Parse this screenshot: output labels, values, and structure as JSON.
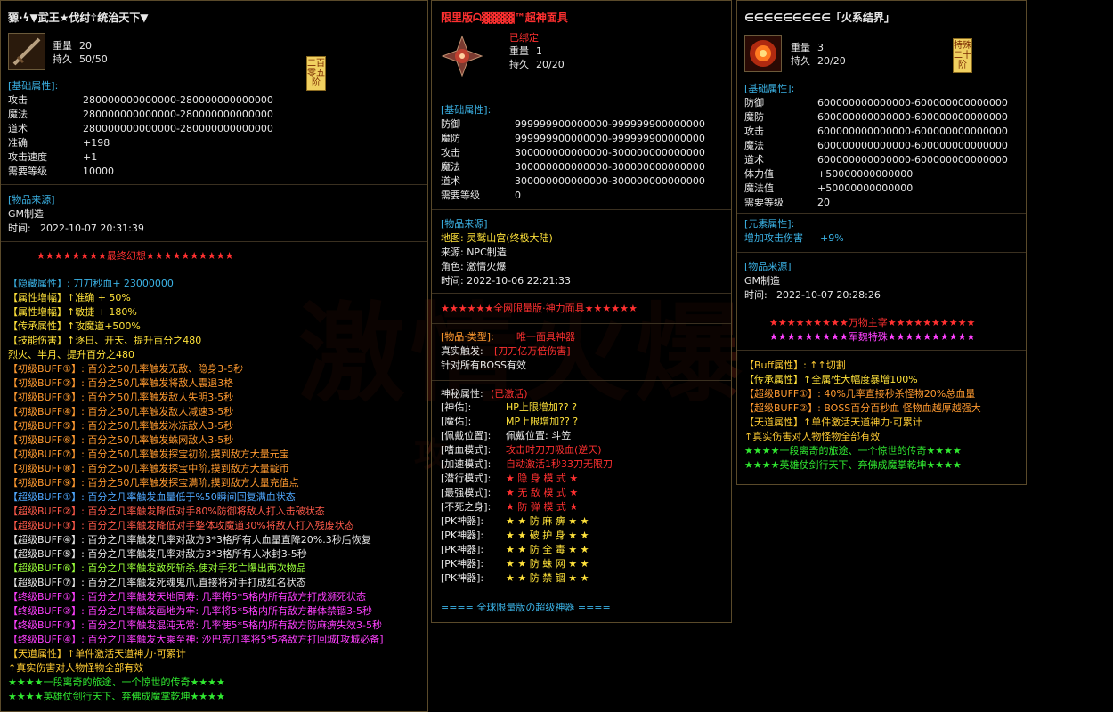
{
  "p1": {
    "title": "豲·ϟ▼武王★伐纣☦统治天下▼",
    "weight_label": "重量",
    "weight": "20",
    "durability_label": "持久",
    "durability": "50/50",
    "seal": "二百零五阶",
    "base_header": "[基础属性]:",
    "base": [
      {
        "k": "攻击",
        "v": "280000000000000-280000000000000"
      },
      {
        "k": "魔法",
        "v": "280000000000000-280000000000000"
      },
      {
        "k": "道术",
        "v": "280000000000000-280000000000000"
      },
      {
        "k": "准确",
        "v": "+198"
      },
      {
        "k": "攻击速度",
        "v": "+1"
      },
      {
        "k": "需要等级",
        "v": "10000"
      }
    ],
    "source_header": "[物品来源]",
    "source": "GM制造",
    "time_label": "时间:",
    "time": "2022-10-07 20:31:39",
    "banner": "★★★★★★★★最终幻想★★★★★★★★★★",
    "lines": [
      {
        "t": "【隐藏属性】: 刀刀秒血+ 23000000",
        "c": "c-cyan"
      },
      {
        "t": "【属性增幅】↑准确 + 50%",
        "c": "c-yellow"
      },
      {
        "t": "【属性增幅】↑敏捷 + 180%",
        "c": "c-yellow"
      },
      {
        "t": "【传承属性】↑攻魔道+500%",
        "c": "c-yellow"
      },
      {
        "t": "【技能伤害】↑逐日、开天、提升百分之480",
        "c": "c-yellow"
      },
      {
        "t": "              烈火、半月、提升百分之480",
        "c": "c-yellow"
      },
      {
        "t": "【初级BUFF①】: 百分之50几率触发无敌、隐身3-5秒",
        "c": "c-orange"
      },
      {
        "t": "【初级BUFF②】: 百分之50几率触发将敌人震退3格",
        "c": "c-orange"
      },
      {
        "t": "【初级BUFF③】: 百分之50几率触发敌人失明3-5秒",
        "c": "c-orange"
      },
      {
        "t": "【初级BUFF④】: 百分之50几率触发敌人减速3-5秒",
        "c": "c-orange"
      },
      {
        "t": "【初级BUFF⑤】: 百分之50几率触发冰冻敌人3-5秒",
        "c": "c-orange"
      },
      {
        "t": "【初级BUFF⑥】: 百分之50几率触发蛛网敌人3-5秒",
        "c": "c-orange"
      },
      {
        "t": "【初级BUFF⑦】: 百分之50几率触发探宝初阶,摸到敌方大量元宝",
        "c": "c-orange"
      },
      {
        "t": "【初级BUFF⑧】: 百分之50几率触发探宝中阶,摸到敌方大量靛币",
        "c": "c-orange"
      },
      {
        "t": "【初级BUFF⑨】: 百分之50几率触发探宝满阶,摸到敌方大量充值点",
        "c": "c-orange"
      },
      {
        "t": "【超级BUFF①】: 百分之几率触发血量低于%50瞬间回复满血状态",
        "c": "c-blue"
      },
      {
        "t": "【超级BUFF②】: 百分之几率触发降低对手80%防御将敌人打入击破状态",
        "c": "c-redl"
      },
      {
        "t": "【超级BUFF③】: 百分之几率触发降低对手整体攻魔道30%将敌人打入残废状态",
        "c": "c-redl"
      },
      {
        "t": "【超级BUFF④】: 百分之几率触发几率对敌方3*3格所有人血量直降20%.3秒后恢复",
        "c": "c-white"
      },
      {
        "t": "【超级BUFF⑤】: 百分之几率触发几率对敌方3*3格所有人冰封3-5秒",
        "c": "c-white"
      },
      {
        "t": "【超级BUFF⑥】: 百分之几率触发致死斩杀,使对手死亡爆出两次物品",
        "c": "c-lime"
      },
      {
        "t": "【超级BUFF⑦】: 百分之几率触发死魂鬼爪,直接将对手打成红名状态",
        "c": "c-white"
      },
      {
        "t": "【终级BUFF①】: 百分之几率触发天地同寿: 几率将5*5格内所有敌方打成濒死状态",
        "c": "c-magenta"
      },
      {
        "t": "【终级BUFF②】: 百分之几率触发画地为牢: 几率将5*5格内所有敌方群体禁锢3-5秒",
        "c": "c-magenta"
      },
      {
        "t": "【终级BUFF③】: 百分之几率触发混沌无常: 几率使5*5格内所有敌方防麻痹失效3-5秒",
        "c": "c-magenta"
      },
      {
        "t": "【终级BUFF④】: 百分之几率触发大乘至神: 沙巴克几率将5*5格敌方打回城[攻城必备]",
        "c": "c-magenta"
      },
      {
        "t": "         【天道属性】↑单件激活天道神力·可累计",
        "c": "c-gold"
      },
      {
        "t": "                 ↑真实伤害对人物怪物全部有效",
        "c": "c-gold"
      },
      {
        "t": "     ★★★★一段离奇的旅途、一个惊世的传奇★★★★",
        "c": "c-green"
      },
      {
        "t": "     ★★★★英雄仗剑行天下、弃佛成魔掌乾坤★★★★",
        "c": "c-green"
      }
    ]
  },
  "p2": {
    "title": "限里版ᗣ▓▓▓▓™超神面具",
    "bound": "已绑定",
    "weight_label": "重量",
    "weight": "1",
    "durability_label": "持久",
    "durability": "20/20",
    "base_header": "[基础属性]:",
    "base": [
      {
        "k": "防御",
        "v": "999999900000000-999999900000000"
      },
      {
        "k": "魔防",
        "v": "999999900000000-999999900000000"
      },
      {
        "k": "攻击",
        "v": "300000000000000-300000000000000"
      },
      {
        "k": "魔法",
        "v": "300000000000000-300000000000000"
      },
      {
        "k": "道术",
        "v": "300000000000000-300000000000000"
      },
      {
        "k": "需要等级",
        "v": "0"
      }
    ],
    "source_header": "[物品来源]",
    "map_line": "地图: 灵鹫山宫(终极大陆)",
    "src_line": "来源: NPC制造",
    "role_line": "角色: 激情火爆",
    "time_line": "时间: 2022-10-06 22:21:33",
    "banner": "★★★★★★全网限量版·神力面具★★★★★★",
    "type_label": "[物品·类型]:",
    "type_value": "唯一面具神器",
    "true_trigger_label": "真实触发:",
    "true_trigger_value": "[刀刀亿万倍伤害]",
    "boss_line": "针对所有BOSS有效",
    "mystic_label": "神秘属性:",
    "mystic_value": "(已激活)",
    "mystic": [
      {
        "k": "[神佑]:",
        "v": "HP上限增加?? ?"
      },
      {
        "k": "[魔佑]:",
        "v": "MP上限增加?? ?"
      },
      {
        "k": "[佩戴位置]:",
        "v": "佩戴位置: 斗笠",
        "vc": "c-white"
      },
      {
        "k": "[嗜血模式]:",
        "v": "攻击时刀刀吸血(逆天)",
        "vc": "c-red"
      },
      {
        "k": "[加速模式]:",
        "v": "自动激活1秒33刀无限刀",
        "vc": "c-red"
      },
      {
        "k": "[潜行模式]:",
        "v": "★ 隐  身  模  式 ★",
        "vc": "c-red"
      },
      {
        "k": "[最强模式]:",
        "v": "★ 无  敌  模  式 ★",
        "vc": "c-red"
      },
      {
        "k": "[不死之身]:",
        "v": "★ 防  弹  模  式 ★",
        "vc": "c-red"
      },
      {
        "k": "[PK神器]:",
        "v": "★ ★ 防  麻  痹 ★ ★",
        "vc": "c-yellow"
      },
      {
        "k": "[PK神器]:",
        "v": "★ ★ 破  护  身 ★ ★",
        "vc": "c-yellow"
      },
      {
        "k": "[PK神器]:",
        "v": "★ ★ 防  全  毒 ★ ★",
        "vc": "c-yellow"
      },
      {
        "k": "[PK神器]:",
        "v": "★ ★ 防  蛛  网 ★ ★",
        "vc": "c-yellow"
      },
      {
        "k": "[PK神器]:",
        "v": "★ ★ 防  禁  锢 ★ ★",
        "vc": "c-yellow"
      }
    ],
    "footer": "==== 全球限量版の超级神器 ===="
  },
  "p3": {
    "title": "∈∈∈∈∈∈∈∈∈「火系结界」",
    "weight_label": "重量",
    "weight": "3",
    "durability_label": "持久",
    "durability": "20/20",
    "seal": "特殊二十阶",
    "base_header": "[基础属性]:",
    "base": [
      {
        "k": "防御",
        "v": "600000000000000-600000000000000"
      },
      {
        "k": "魔防",
        "v": "600000000000000-600000000000000"
      },
      {
        "k": "攻击",
        "v": "600000000000000-600000000000000"
      },
      {
        "k": "魔法",
        "v": "600000000000000-600000000000000"
      },
      {
        "k": "道术",
        "v": "600000000000000-600000000000000"
      },
      {
        "k": "体力值",
        "v": "+50000000000000"
      },
      {
        "k": "魔法值",
        "v": "+50000000000000"
      },
      {
        "k": "需要等级",
        "v": "20"
      }
    ],
    "element_header": "[元素属性]:",
    "element_label": "增加攻击伤害",
    "element_value": "+9%",
    "source_header": "[物品来源]",
    "source": "GM制造",
    "time_label": "时间:",
    "time": "2022-10-07 20:28:26",
    "banner1": "★★★★★★★★★万物主宰★★★★★★★★★★",
    "banner2": "★★★★★★★★★军魏特殊★★★★★★★★★★",
    "lines": [
      {
        "t": "        【Buff属性】: ↑↑切割",
        "c": "c-gold"
      },
      {
        "t": "          【传承属性】↑全属性大幅度暴增100%",
        "c": "c-yellow"
      },
      {
        "t": "【超级BUFF①】: 40%几率直接秒杀怪物20%总血量",
        "c": "c-orange"
      },
      {
        "t": "【超级BUFF②】: BOSS百分百秒血 怪物血越厚越强大",
        "c": "c-orange"
      },
      {
        "t": "       【天道属性】↑单件激活天道神力·可累计",
        "c": "c-gold"
      },
      {
        "t": "               ↑真实伤害对人物怪物全部有效",
        "c": "c-gold"
      },
      {
        "t": "★★★★一段离奇的旅途、一个惊世的传奇★★★★",
        "c": "c-green"
      },
      {
        "t": "★★★★英雄仗剑行天下、弃佛成魔掌乾坤★★★★",
        "c": "c-green"
      }
    ]
  },
  "watermark": {
    "big": "激情火爆",
    "small": "攻"
  },
  "colors": {
    "bg": "#000000",
    "cyan": "#3bb3e6",
    "yellow": "#ffe23a",
    "red": "#ff3030",
    "green": "#30e830",
    "magenta": "#ff40ff",
    "orange": "#ff9a30"
  }
}
